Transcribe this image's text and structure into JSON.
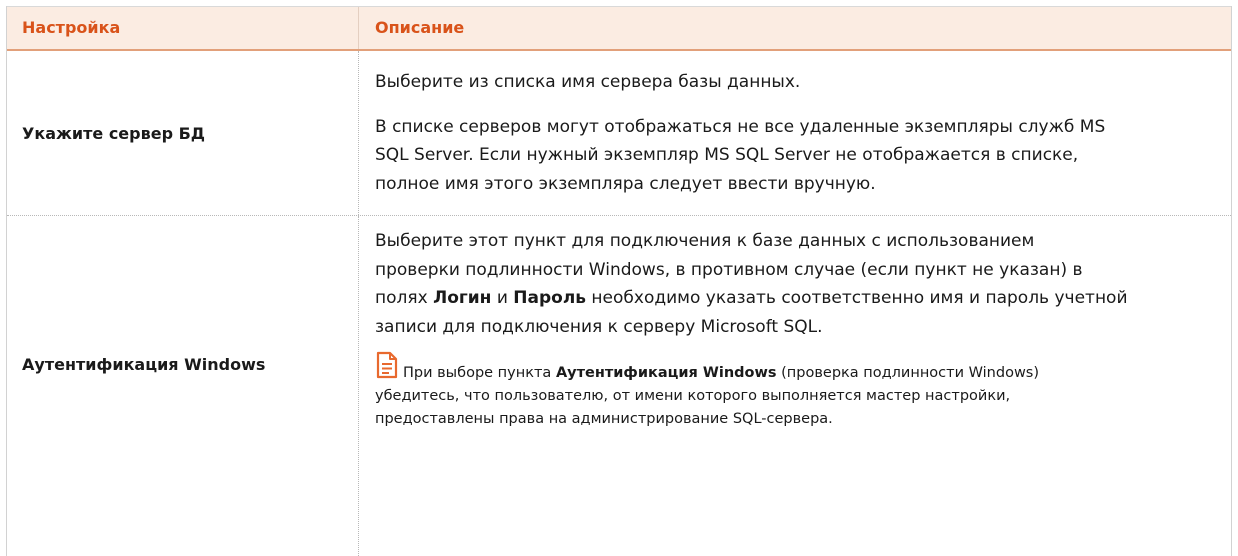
{
  "table": {
    "header": {
      "setting": "Настройка",
      "description": "Описание"
    },
    "rows": [
      {
        "setting": "Укажите сервер БД",
        "p1": "Выберите из списка имя сервера базы данных.",
        "p2_line1": "В списке серверов могут отображаться не все удаленные экземпляры служб MS",
        "p2_line2": "SQL Server. Если нужный экземпляр MS SQL Server не отображается в списке,",
        "p2_line3": "полное имя этого экземпляра следует ввести вручную."
      },
      {
        "setting": "Аутентификация Windows",
        "l1": "Выберите этот пункт для подключения к базе данных с использованием",
        "l2": "проверки подлинности Windows, в противном случае (если пункт не указан) в",
        "l3_pre": "полях ",
        "l3_b1": "Логин",
        "l3_mid": " и ",
        "l3_b2": "Пароль",
        "l3_post": " необходимо указать соответственно имя и пароль учетной",
        "l4": "записи для подключения к серверу Microsoft SQL.",
        "note": {
          "icon": "note-icon",
          "pre": "При выборе пункта ",
          "bold": "Аутентификация Windows",
          "post1": " (проверка подлинности Windows)",
          "l2": "убедитесь, что пользователю, от имени которого выполняется мастер настройки,",
          "l3": "предоставлены права на администрирование SQL-сервера."
        }
      }
    ]
  },
  "colors": {
    "header_bg": "#fbece2",
    "header_text": "#d9531a",
    "note_icon": "#e8692e"
  }
}
